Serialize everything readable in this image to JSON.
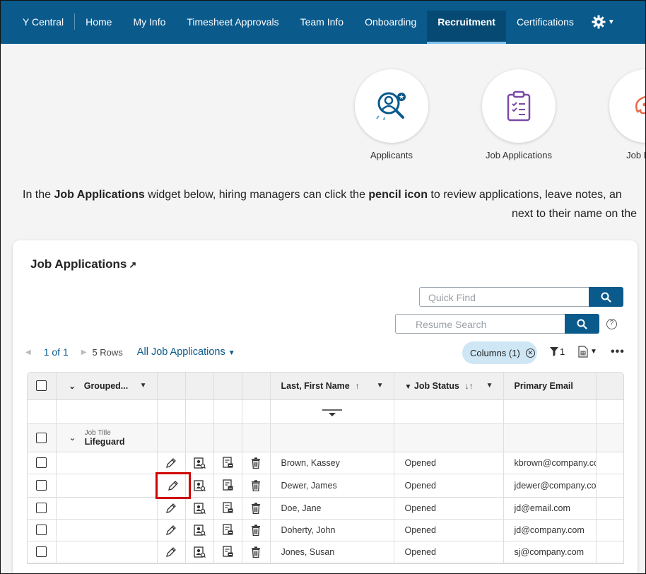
{
  "nav": {
    "items": [
      {
        "label": "Y Central"
      },
      {
        "label": "Home"
      },
      {
        "label": "My Info"
      },
      {
        "label": "Timesheet Approvals"
      },
      {
        "label": "Team Info"
      },
      {
        "label": "Onboarding"
      },
      {
        "label": "Recruitment",
        "active": true
      },
      {
        "label": "Certifications"
      }
    ],
    "settings_icon": "gear-icon"
  },
  "widgets": [
    {
      "label": "Applicants",
      "icon": "applicant-search-icon"
    },
    {
      "label": "Job Applications",
      "icon": "clipboard-checklist-icon"
    },
    {
      "label": "Job Requ",
      "icon": "network-head-icon"
    }
  ],
  "intro": {
    "line1_a": "In the ",
    "line1_b": "Job Applications",
    "line1_c": " widget below, hiring managers can click the ",
    "line1_d": "pencil icon",
    "line1_e": " to review applications, leave notes, an",
    "line2": "next to their name on the"
  },
  "card": {
    "title": "Job Applications",
    "title_arrow": "↗",
    "quick_find_placeholder": "Quick Find",
    "resume_search_placeholder": "Resume Search",
    "help": "?",
    "pager": {
      "page": "1 of 1",
      "rows": "5 Rows",
      "view": "All Job Applications"
    },
    "columns_pill": "Columns (1)",
    "filter_count": "1"
  },
  "grid": {
    "headers": {
      "grouped": "Grouped...",
      "name": "Last, First Name",
      "status": "Job Status",
      "email": "Primary Email"
    },
    "group": {
      "label": "Job Title",
      "value": "Lifeguard"
    },
    "rows": [
      {
        "name": "Brown, Kassey",
        "status": "Opened",
        "email": "kbrown@company.co"
      },
      {
        "name": "Dewer, James",
        "status": "Opened",
        "email": "jdewer@company.con",
        "highlighted": true
      },
      {
        "name": "Doe, Jane",
        "status": "Opened",
        "email": "jd@email.com"
      },
      {
        "name": "Doherty, John",
        "status": "Opened",
        "email": "jd@company.com"
      },
      {
        "name": "Jones, Susan",
        "status": "Opened",
        "email": "sj@company.com"
      }
    ]
  },
  "colors": {
    "nav": "#0a5a8c",
    "nav_active": "#064a73",
    "accent": "#0a5a8c",
    "highlight": "#d00000",
    "pill": "#cfe6f4"
  }
}
